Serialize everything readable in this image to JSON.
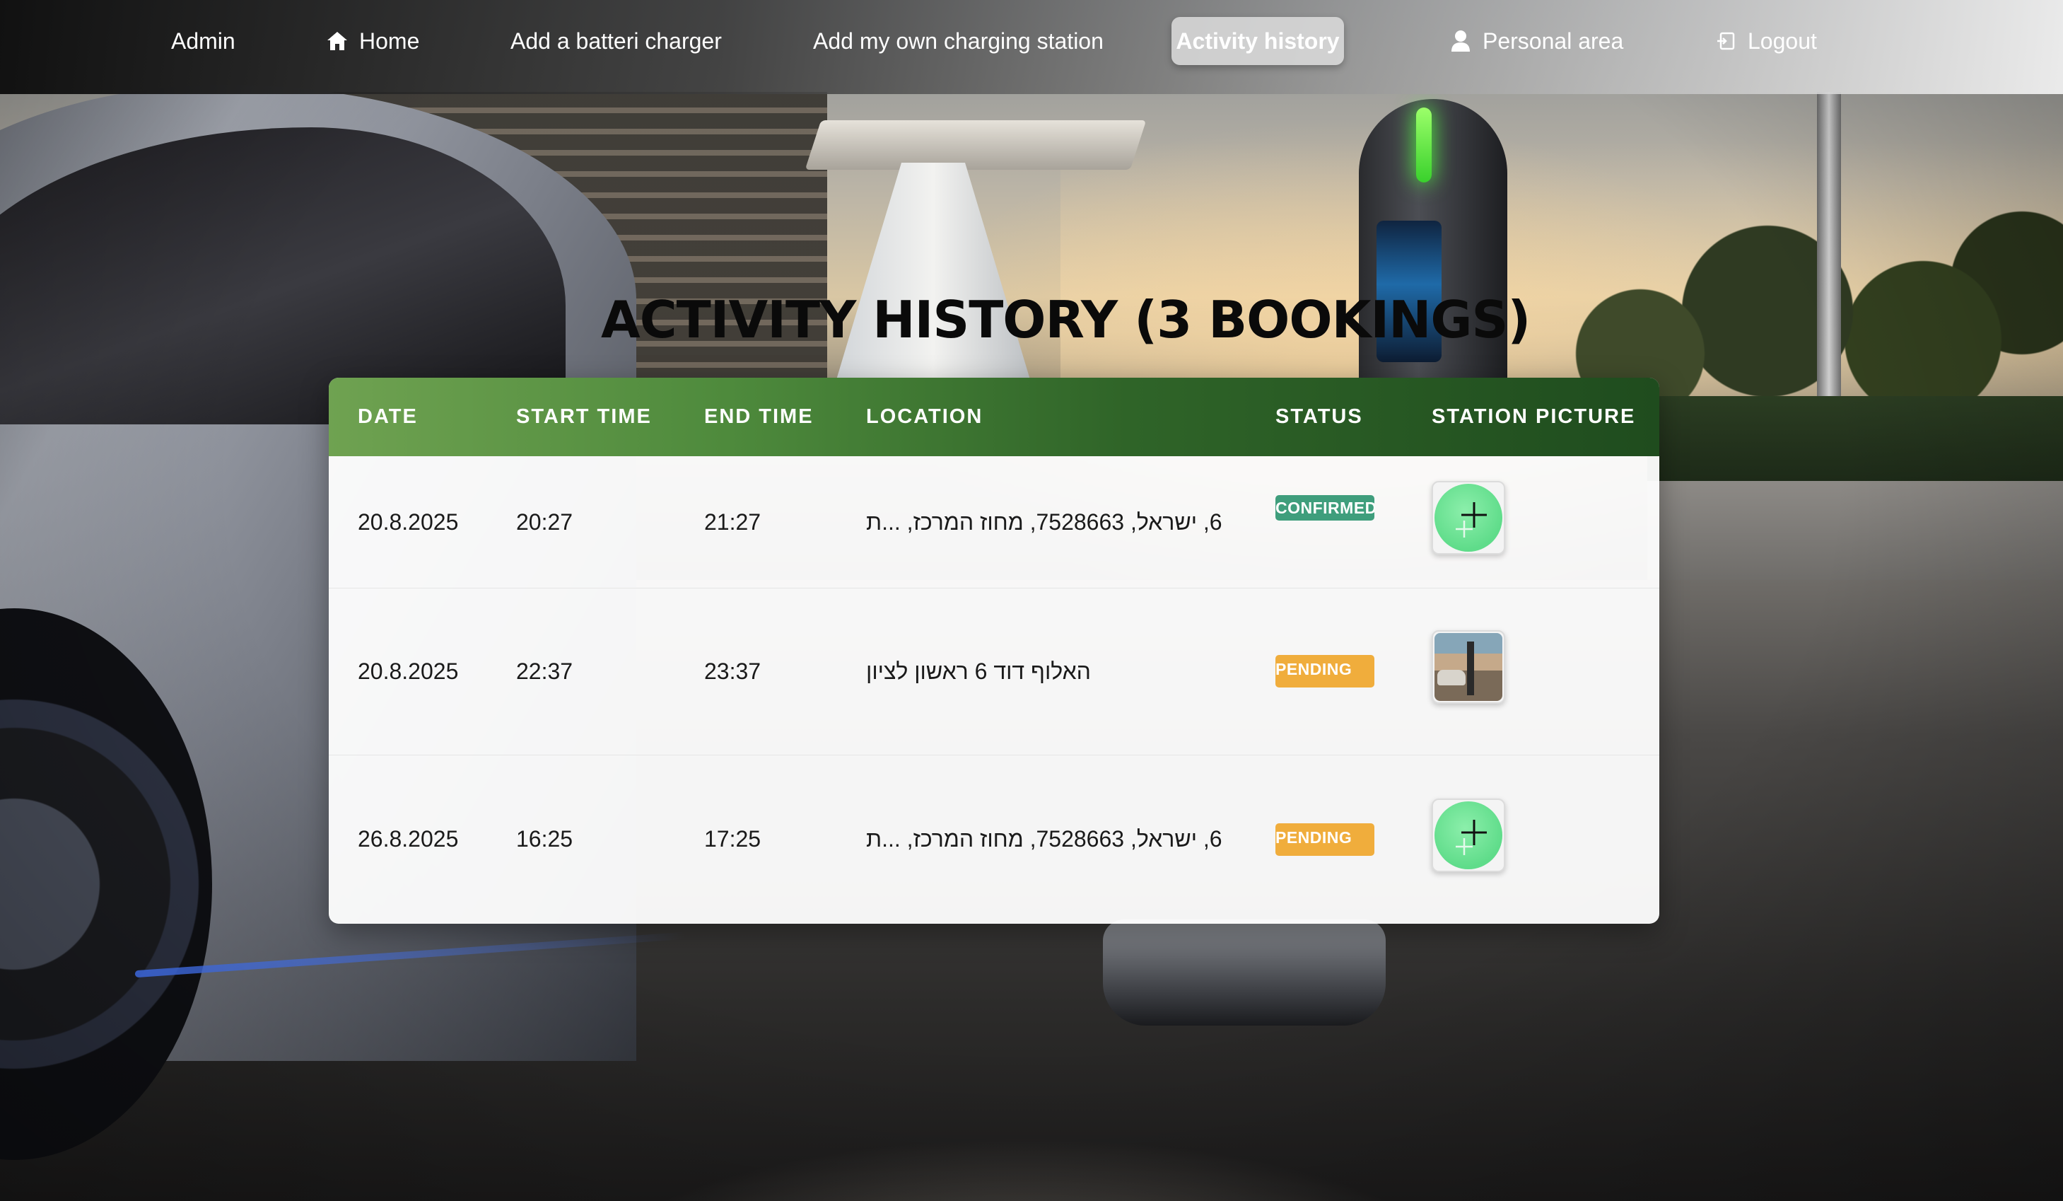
{
  "nav": {
    "admin": "Admin",
    "home": "Home",
    "add_battery_charger": "Add a batteri charger",
    "add_own_station": "Add my own charging station",
    "activity_history": "Activity history",
    "personal_area": "Personal area",
    "logout": "Logout",
    "active_item": "Activity history",
    "icons": {
      "home": "home-icon",
      "personal_area": "user-icon",
      "logout": "logout-icon"
    }
  },
  "page": {
    "title": "ACTIVITY HISTORY (3 BOOKINGS)"
  },
  "table": {
    "headers": {
      "date": "DATE",
      "start_time": "START TIME",
      "end_time": "END TIME",
      "location": "LOCATION",
      "status": "STATUS",
      "station_picture": "STATION PICTURE"
    },
    "rows": [
      {
        "date": "20.8.2025",
        "start_time": "20:27",
        "end_time": "21:27",
        "location": "6, ישראל, 7528663, מחוז המרכז, ...ת",
        "status": "CONFIRMED",
        "picture": "plus-icon"
      },
      {
        "date": "20.8.2025",
        "start_time": "22:37",
        "end_time": "23:37",
        "location": "האלוף דוד 6 ראשון לציון",
        "status": "PENDING",
        "picture": "station-photo"
      },
      {
        "date": "26.8.2025",
        "start_time": "16:25",
        "end_time": "17:25",
        "location": "6, ישראל, 7528663, מחוז המרכז, ...ת",
        "status": "PENDING",
        "picture": "plus-icon"
      }
    ]
  },
  "colors": {
    "header_green_start": "#6fa251",
    "header_green_end": "#1f4c1e",
    "confirmed_badge": "#3f9e7c",
    "pending_badge": "#f0ad3c",
    "plus_circle": "#5fdc8a"
  }
}
